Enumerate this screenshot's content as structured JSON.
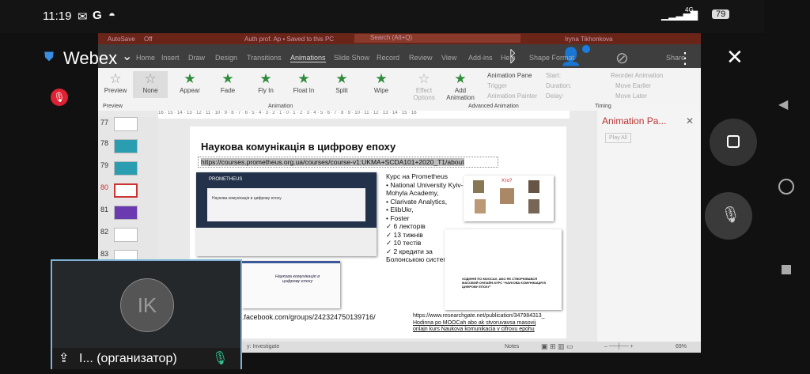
{
  "status_bar": {
    "time": "11:19",
    "icons": [
      "gmail-icon",
      "google-icon",
      "wechat-icon"
    ],
    "network": "4G",
    "battery": "79"
  },
  "webex": {
    "title": "Webex",
    "mute_indicator": "mic-muted-icon"
  },
  "ppt": {
    "titlebar": {
      "autosave": "AutoSave",
      "autosave_state": "Off",
      "filename": "Auth prof. Ap • Saved to this PC",
      "search": "Search (Alt+Q)",
      "user": "Iryna Tikhonkova"
    },
    "tabs": [
      "Home",
      "Insert",
      "Draw",
      "Design",
      "Transitions",
      "Animations",
      "Slide Show",
      "Record",
      "Review",
      "View",
      "Add-ins",
      "Help",
      "Shape Format",
      "Share"
    ],
    "ribbon": {
      "preview": "Preview",
      "preview_group": "Preview",
      "animations": [
        "None",
        "Appear",
        "Fade",
        "Fly In",
        "Float In",
        "Split",
        "Wipe"
      ],
      "effect_options": "Effect Options",
      "animation_group": "Animation",
      "add_animation": "Add Animation",
      "animation_pane": "Animation Pane",
      "trigger": "Trigger",
      "animation_painter": "Animation Painter",
      "advanced_group": "Advanced Animation",
      "start": "Start:",
      "duration": "Duration:",
      "delay": "Delay:",
      "timing_group": "Timing",
      "reorder": "Reorder Animation",
      "move_earlier": "Move Earlier",
      "move_later": "Move Later"
    },
    "ruler": "16 · 15 · 14 · 13 · 12 · 11 · 10 · 9 · 8 · 7 · 6 · 5 · 4 · 3 · 2 · 1 · 0 · 1 · 2 · 3 · 4 · 5 · 6 · 7 · 8 · 9 · 10 · 11 · 12 · 13 · 14 · 15 · 16",
    "thumbnails": [
      "77",
      "78",
      "79",
      "80",
      "81",
      "82",
      "83"
    ],
    "slide": {
      "title": "Наукова комунікація в цифрову епоху",
      "link": "https://courses.prometheus.org.ua/courses/course-v1:UKMA+SCDA101+2020_T1/about",
      "screenshot_title": "Наукова комунікація в цифрову епоху",
      "screenshot_brand": "PROMETHEUS",
      "fb_title": "Наукова комунікація в цифрову епоху",
      "course_heading": "Курс на Prometheus",
      "bullets": [
        "National University Kyiv-Mohyla Academy,",
        "Clarivate Analytics,",
        "ElibUkr,",
        "Foster"
      ],
      "checks": [
        "6 лекторів",
        "13 тижнів",
        "10 тестів",
        "2 кредити за Болонською системою"
      ],
      "who": "Хто?",
      "paper_title": "ХОДІННЯ ПО MOOCАХ, АБО ЯК СТВОРЮВАВСЯ МАСОВИЙ ОНЛАЙН-КУРС \"НАУКОВА КОМУНІКАЦІЯ В ЦИФРОВУ ЕПОХУ\"",
      "fb_link": ".facebook.com/groups/242324750139716/",
      "rg_link": "https://www.researchgate.net/publication/347984313_",
      "rg_text": "Hodinna po MOOCah abo ak stvoruvavsa masovij onlajn kurs Naukova komunikacia v cifrovu epohu"
    },
    "pane": {
      "title": "Animation Pa...",
      "play_all": "Play All"
    },
    "statusbar": {
      "accessibility": "y: Investigate",
      "notes": "Notes",
      "zoom": "69%"
    }
  },
  "self_view": {
    "initials": "IK",
    "name": "I... (организатор)"
  }
}
